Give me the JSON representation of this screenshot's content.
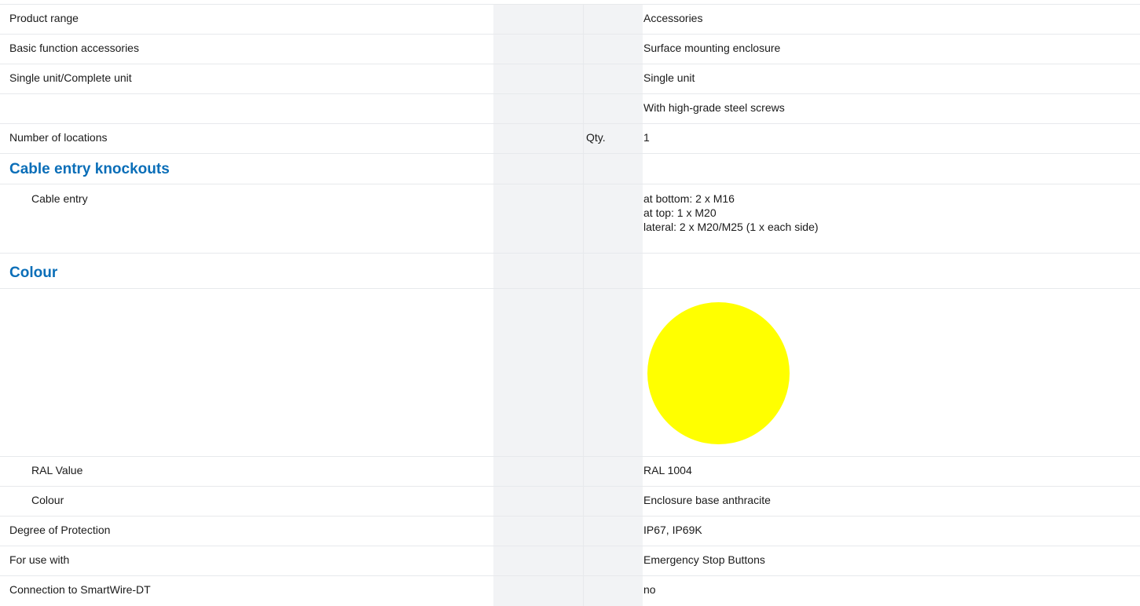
{
  "rows": [
    {
      "label": "Product range",
      "unit": "",
      "value": "Accessories"
    },
    {
      "label": "Basic function accessories",
      "unit": "",
      "value": "Surface mounting enclosure"
    },
    {
      "label": "Single unit/Complete unit",
      "unit": "",
      "value": "Single unit"
    },
    {
      "label": "",
      "unit": "",
      "value": "With high-grade steel screws"
    },
    {
      "label": "Number of locations",
      "unit": "Qty.",
      "value": "1"
    }
  ],
  "sections": {
    "cable_entry": {
      "title": "Cable entry knockouts",
      "items": [
        {
          "label": "Cable entry",
          "value": "at bottom: 2 x M16\nat top: 1 x M20\nlateral: 2 x M20/M25 (1 x each side)"
        }
      ]
    },
    "colour": {
      "title": "Colour",
      "swatch_color": "#ffff00",
      "items": [
        {
          "label": "RAL Value",
          "value": "RAL 1004"
        },
        {
          "label": "Colour",
          "value": "Enclosure base anthracite"
        }
      ]
    }
  },
  "tail_rows": [
    {
      "label": "Degree of Protection",
      "value": "IP67, IP69K"
    },
    {
      "label": "For use with",
      "value": "Emergency Stop Buttons"
    },
    {
      "label": "Connection to SmartWire-DT",
      "value": "no"
    }
  ]
}
